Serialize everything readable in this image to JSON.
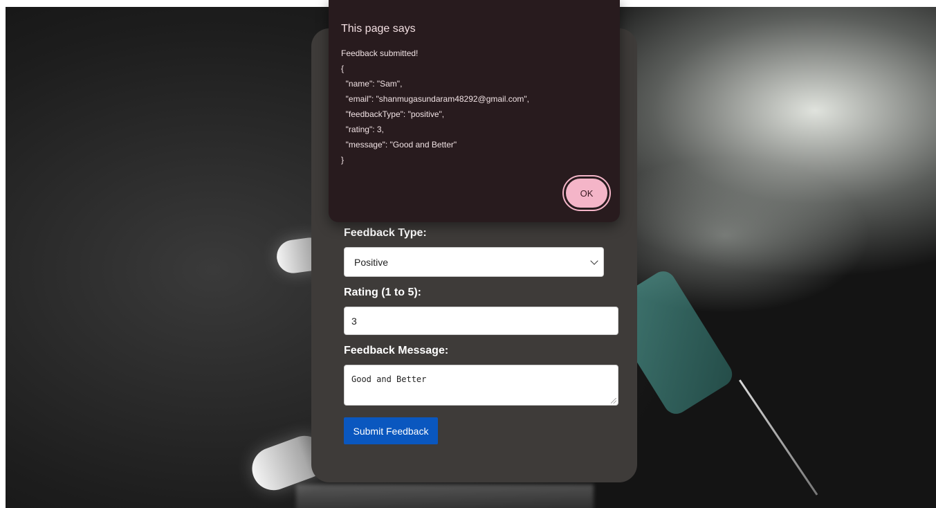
{
  "dialog": {
    "title": "This page says",
    "lines": [
      "Feedback submitted!",
      "{",
      "  \"name\": \"Sam\",",
      "  \"email\": \"shanmugasundaram48292@gmail.com\",",
      "  \"feedbackType\": \"positive\",",
      "  \"rating\": 3,",
      "  \"message\": \"Good and Better\"",
      "}"
    ],
    "ok_label": "OK"
  },
  "form": {
    "feedback_type_label": "Feedback Type:",
    "feedback_type_value": "Positive",
    "rating_label": "Rating (1 to 5):",
    "rating_value": "3",
    "message_label": "Feedback Message:",
    "message_value": "Good and Better",
    "submit_label": "Submit Feedback"
  },
  "colors": {
    "card_bg": "#3e3b39",
    "dialog_bg": "#281b1e",
    "ok_button": "#f4b5c8",
    "submit_button": "#0a57bf"
  }
}
